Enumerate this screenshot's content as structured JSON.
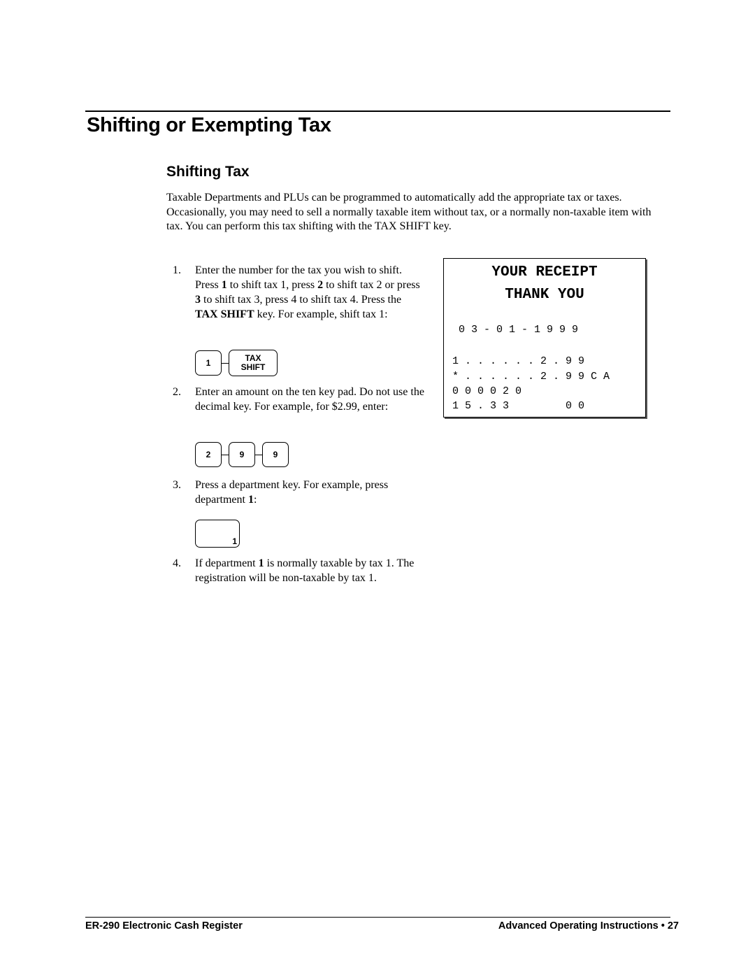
{
  "header": {
    "chapter_title": "Shifting or Exempting Tax",
    "section_title": "Shifting Tax"
  },
  "intro": "Taxable Departments and PLUs can be programmed to automatically add the appropriate tax or taxes.  Occasionally, you may need to sell a normally taxable item without tax, or a normally non-taxable item with tax.  You can perform this tax shifting with the TAX SHIFT key.",
  "steps": [
    {
      "number": "1.",
      "parts": [
        "Enter the number for the tax you wish to shift.  Press ",
        "1",
        " to shift tax 1, press ",
        "2",
        " to shift tax 2 or press ",
        "3",
        " to shift tax 3, press 4 to shift tax 4.  Press the ",
        "TAX SHIFT",
        " key.  For example, shift tax 1:"
      ],
      "keys": [
        "1",
        "TAX",
        "SHIFT"
      ]
    },
    {
      "number": "2.",
      "text": "Enter an amount on the ten key pad.  Do not use the decimal key.  For example, for $2.99, enter:",
      "keys": [
        "2",
        "9",
        "9"
      ]
    },
    {
      "number": "3.",
      "parts": [
        "Press a department key.  For example, press department ",
        "1",
        ":"
      ],
      "keys": [
        "1"
      ]
    },
    {
      "number": "4.",
      "parts": [
        "If department ",
        "1",
        " is normally taxable by tax 1.  The registration will be non-taxable by tax 1."
      ]
    }
  ],
  "receipt": {
    "header_line1": "YOUR RECEIPT",
    "header_line2": "THANK YOU",
    "date": "0 3 - 0 1 - 1 9 9 9",
    "lines": [
      "1 . . . . . . 2 . 9 9",
      "* . . . . . . 2 . 9 9 C A",
      "0 0 0 0 2 0",
      "1 5 . 3 3         0 0"
    ]
  },
  "footer": {
    "left": "ER-290 Electronic Cash Register",
    "right": "Advanced Operating Instructions • 27"
  }
}
